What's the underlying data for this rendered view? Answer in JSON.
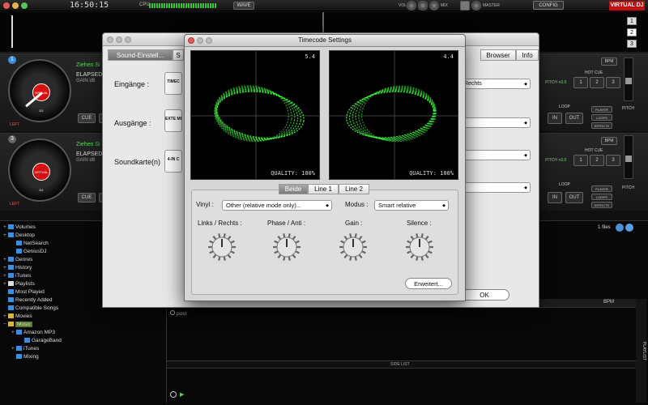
{
  "app": {
    "clock": "16:50:15",
    "cpu_label": "CPU",
    "wave_label": "WAVE",
    "vol_label": "VOL",
    "mix_label": "MIX",
    "master_label": "MASTER",
    "config_label": "CONFIG",
    "logo": "VIRTUAL DJ",
    "deck_selectors": [
      "1",
      "2",
      "3"
    ]
  },
  "decks": [
    {
      "number": "1",
      "title": "Ziehen Si",
      "elapsed": "ELAPSED",
      "gain": "GAIN dB",
      "record_label": "VIRTUAL DJ",
      "cue": "CUE",
      "side": "LEFT",
      "hot_cue": "HOT CUE",
      "hot_cues": [
        "1",
        "2",
        "3"
      ],
      "loop": "LOOP",
      "in": "IN",
      "out": "OUT",
      "player": "PLAYER",
      "loops": "LOOPS",
      "effects": "EFFECTS",
      "pitch": "PITCH",
      "bpm": "BPM",
      "pitch_value": "PITCH +0.0"
    },
    {
      "number": "3",
      "title": "Ziehen Si",
      "elapsed": "ELAPSED",
      "gain": "GAIN dB",
      "record_label": "VIRTUAL DJ",
      "cue": "CUE",
      "side": "LEFT",
      "hot_cue": "HOT CUE",
      "hot_cues": [
        "1",
        "2",
        "3"
      ],
      "loop": "LOOP",
      "in": "IN",
      "out": "OUT",
      "player": "PLAYER",
      "loops": "LOOPS",
      "effects": "EFFECTS",
      "pitch": "PITCH",
      "bpm": "BPM",
      "pitch_value": "PITCH +0.0"
    }
  ],
  "browser": {
    "tree": [
      {
        "label": "Volumes",
        "plus": "+",
        "indent": 0,
        "color": "#3a8ee0"
      },
      {
        "label": "Desktop",
        "plus": "+",
        "indent": 0,
        "color": "#3a8ee0"
      },
      {
        "label": "NetSearch",
        "plus": "",
        "indent": 1,
        "color": "#3a8ee0"
      },
      {
        "label": "GeniusDJ",
        "plus": "",
        "indent": 1,
        "color": "#3a8ee0"
      },
      {
        "label": "Genres",
        "plus": "+",
        "indent": 0,
        "color": "#3a8ee0"
      },
      {
        "label": "History",
        "plus": "+",
        "indent": 0,
        "color": "#3a8ee0"
      },
      {
        "label": "iTunes",
        "plus": "+",
        "indent": 0,
        "color": "#3a8ee0"
      },
      {
        "label": "Playlists",
        "plus": "+",
        "indent": 0,
        "color": "#dddddd"
      },
      {
        "label": "Most Played",
        "plus": "",
        "indent": 0,
        "color": "#3a8ee0"
      },
      {
        "label": "Recently Added",
        "plus": "",
        "indent": 0,
        "color": "#3a8ee0"
      },
      {
        "label": "Compatible Songs",
        "plus": "",
        "indent": 0,
        "color": "#3a8ee0"
      },
      {
        "label": "Movies",
        "plus": "+",
        "indent": 0,
        "color": "#d9b43a"
      },
      {
        "label": "Music",
        "plus": "−",
        "indent": 0,
        "color": "#d9b43a",
        "selected": true
      },
      {
        "label": "Amazon MP3",
        "plus": "+",
        "indent": 1,
        "color": "#3a8ee0"
      },
      {
        "label": "GarageBand",
        "plus": "",
        "indent": 2,
        "color": "#3a8ee0"
      },
      {
        "label": "iTunes",
        "plus": "+",
        "indent": 1,
        "color": "#3a8ee0"
      },
      {
        "label": "Mixing",
        "plus": "",
        "indent": 1,
        "color": "#3a8ee0"
      }
    ],
    "files_count": "1 files",
    "column_bpm": "BPM",
    "file_row": "post",
    "side_list": "SIDE LIST",
    "playlist_tab": "PLAYLIST"
  },
  "sound_window": {
    "tabs": [
      "Sound-Einstell...",
      "S",
      "Browser",
      "Info"
    ],
    "labels": {
      "inputs": "Eingänge :",
      "outputs": "Ausgänge :",
      "soundcard": "Soundkarte(n)"
    },
    "boxes": {
      "inputs": "TIMEC",
      "outputs": "EXTE MI",
      "soundcard": "4-IN C"
    },
    "selects": [
      "ck Rechts",
      "e",
      "",
      ""
    ],
    "ok_label": "OK"
  },
  "timecode": {
    "title": "Timecode Settings",
    "scope_left_value": "5.4",
    "scope_right_value": "4.4",
    "quality_left": "QUALITY: 100%",
    "quality_right": "QUALITY: 100%",
    "tabs": [
      "Beide",
      "Line 1",
      "Line 2"
    ],
    "vinyl_label": "Vinyl :",
    "vinyl_value": "Other (relative mode only)...",
    "modus_label": "Modus :",
    "modus_value": "Smart relative",
    "knobs": [
      "Links / Rechts :",
      "Phase / Anti :",
      "Gain :",
      "Silence :"
    ],
    "advanced_label": "Erweitert...",
    "scope_color": "#3aff3a"
  }
}
